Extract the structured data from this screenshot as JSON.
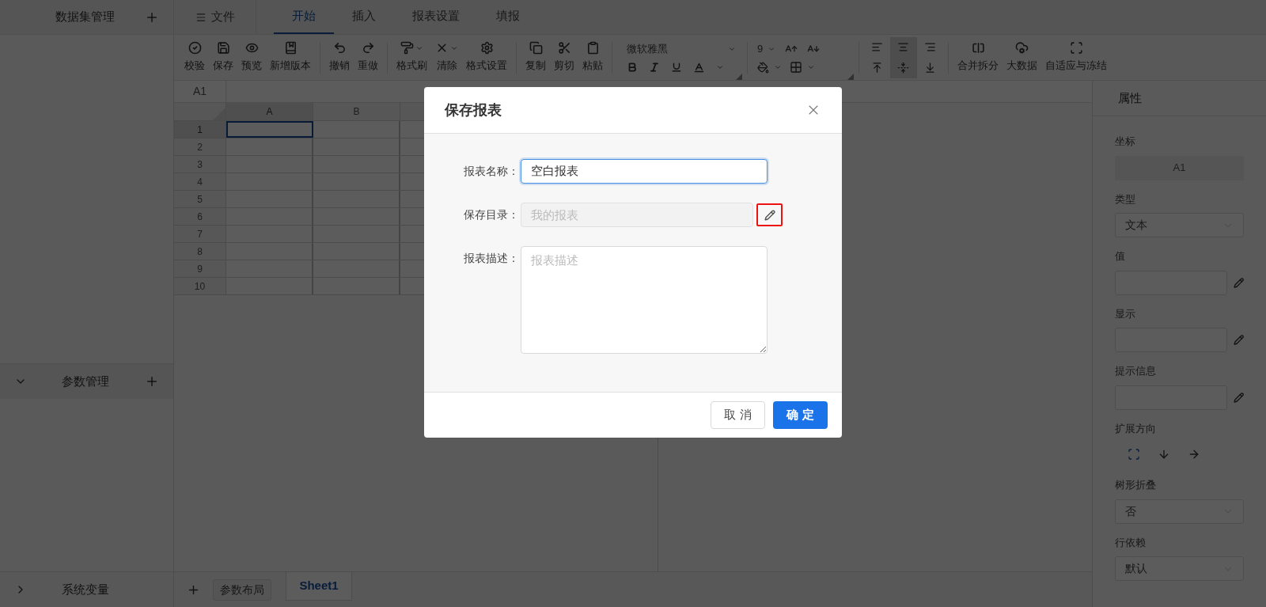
{
  "sidebar": {
    "title": "数据集管理",
    "sections": [
      {
        "title": "参数管理",
        "expanded": true
      },
      {
        "title": "系统变量",
        "expanded": false
      }
    ]
  },
  "menu": {
    "label": "文件"
  },
  "tabs": [
    {
      "label": "开始",
      "selected": true
    },
    {
      "label": "插入",
      "selected": false
    },
    {
      "label": "报表设置",
      "selected": false
    },
    {
      "label": "填报",
      "selected": false
    }
  ],
  "toolbar": {
    "groups": [
      [
        {
          "label": "校验",
          "dropdown": false
        },
        {
          "label": "保存",
          "dropdown": false
        },
        {
          "label": "预览",
          "dropdown": false
        },
        {
          "label": "新增版本",
          "dropdown": false
        }
      ],
      [
        {
          "label": "撤销",
          "dropdown": false
        },
        {
          "label": "重做",
          "dropdown": false
        }
      ],
      [
        {
          "label": "格式刷",
          "dropdown": true
        },
        {
          "label": "清除",
          "dropdown": true
        },
        {
          "label": "格式设置",
          "dropdown": false
        }
      ],
      [
        {
          "label": "复制",
          "dropdown": false
        },
        {
          "label": "剪切",
          "dropdown": false
        },
        {
          "label": "粘贴",
          "dropdown": false
        }
      ]
    ],
    "font": {
      "family": "微软雅黑",
      "size": "9"
    },
    "align": [
      {
        "selected": false
      },
      {
        "selected": true
      },
      {
        "selected": false
      },
      {
        "selected": false
      },
      {
        "selected": true
      },
      {
        "selected": false
      }
    ],
    "extras": [
      {
        "label": "合并拆分"
      },
      {
        "label": "大数据"
      },
      {
        "label": "自适应与冻结"
      }
    ]
  },
  "sheet": {
    "name_box": "A1",
    "columns": [
      {
        "label": "A",
        "selected": true
      },
      {
        "label": "B",
        "selected": false
      }
    ],
    "rows": [
      {
        "label": "1",
        "selected": true
      },
      {
        "label": "2",
        "selected": false
      },
      {
        "label": "3",
        "selected": false
      },
      {
        "label": "4",
        "selected": false
      },
      {
        "label": "5",
        "selected": false
      },
      {
        "label": "6",
        "selected": false
      },
      {
        "label": "7",
        "selected": false
      },
      {
        "label": "8",
        "selected": false
      },
      {
        "label": "9",
        "selected": false
      },
      {
        "label": "10",
        "selected": false
      }
    ]
  },
  "properties": {
    "title": "属性",
    "fields": [
      {
        "kind": "readonly",
        "label": "坐标",
        "value": "A1"
      },
      {
        "kind": "select",
        "label": "类型",
        "value": "文本"
      },
      {
        "kind": "edit",
        "label": "值"
      },
      {
        "kind": "edit",
        "label": "显示"
      },
      {
        "kind": "edit",
        "label": "提示信息"
      },
      {
        "kind": "direction",
        "label": "扩展方向",
        "options": [
          {
            "selected": true
          },
          {
            "selected": false
          },
          {
            "selected": false
          }
        ]
      },
      {
        "kind": "select",
        "label": "树形折叠",
        "value": "否"
      },
      {
        "kind": "select",
        "label": "行依赖",
        "value": "默认"
      }
    ]
  },
  "bottom_bar": {
    "layout_button": "参数布局",
    "sheets": [
      {
        "label": "Sheet1",
        "selected": true
      }
    ]
  },
  "dialog": {
    "title": "保存报表",
    "fields": [
      {
        "kind": "input",
        "label": "报表名称：",
        "value": "空白报表",
        "focused": true
      },
      {
        "kind": "readonly",
        "label": "保存目录：",
        "placeholder": "我的报表",
        "highlighted": true
      },
      {
        "kind": "textarea",
        "label": "报表描述：",
        "placeholder": "报表描述"
      }
    ],
    "buttons": [
      {
        "label": "取 消",
        "kind": "secondary"
      },
      {
        "label": "确 定",
        "kind": "primary"
      }
    ]
  }
}
